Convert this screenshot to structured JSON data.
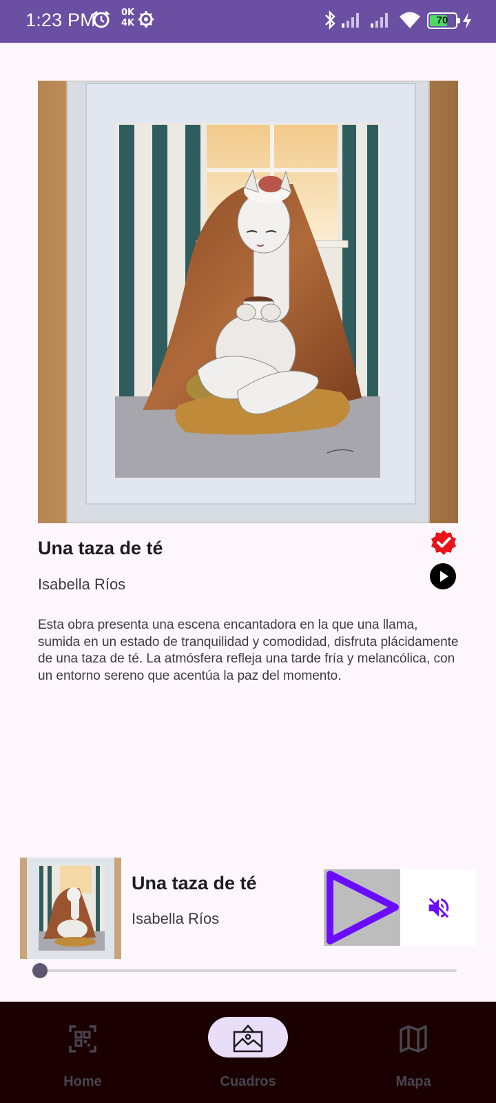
{
  "status_bar": {
    "time": "1:23 PM",
    "speed": [
      "0K",
      "4K"
    ],
    "battery": "70",
    "battery_level": 0.7,
    "icons": [
      "alarm-icon",
      "settings-icon",
      "bluetooth-icon",
      "signal-icon",
      "signal-icon",
      "wifi-icon",
      "battery-icon",
      "charging-icon"
    ]
  },
  "artwork": {
    "title": "Una taza de té",
    "artist": "Isabella Ríos",
    "description": "Esta obra presenta una escena encantadora en la que una llama, sumida en un estado de tranquilidad y comodidad, disfruta plácidamente de una taza de té. La atmósfera refleja una tarde fría y melancólica, con un entorno sereno que acentúa la paz del momento.",
    "verified_icon": "verified-badge-icon",
    "verified_color": "#e8141a"
  },
  "player": {
    "title": "Una taza de té",
    "artist": "Isabella Ríos",
    "progress": 0,
    "play_color": "#6a0dff",
    "mute_color": "#6a0dff"
  },
  "nav": {
    "items": [
      {
        "label": "Home",
        "icon": "qr-scan-icon",
        "active": false
      },
      {
        "label": "Cuadros",
        "icon": "picture-icon",
        "active": true
      },
      {
        "label": "Mapa",
        "icon": "map-icon",
        "active": false
      }
    ]
  }
}
